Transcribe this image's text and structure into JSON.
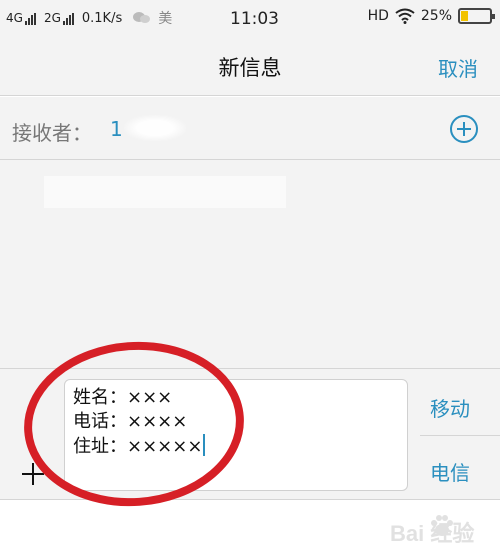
{
  "status_bar": {
    "network1": "4G",
    "network2": "2G",
    "speed": "0.1K/s",
    "app_char": "美",
    "time": "11:03",
    "hd": "HD",
    "battery": "25%",
    "battery_level": 0.25,
    "icons": [
      "signal-icon",
      "wechat-icon",
      "wifi-icon",
      "battery-icon"
    ]
  },
  "header": {
    "title": "新信息",
    "cancel_label": "取消"
  },
  "recipient": {
    "label": "接收者：",
    "value": "1"
  },
  "compose": {
    "lines": [
      "姓名：×××",
      "电话：××××",
      "住址：×××××"
    ],
    "send_mobile_label": "移动",
    "send_telecom_label": "电信"
  },
  "watermark": {
    "text": "Bai  经验"
  },
  "colors": {
    "accent": "#2a8fbf",
    "annotation": "#d61f26",
    "background": "#f3f3f3"
  }
}
